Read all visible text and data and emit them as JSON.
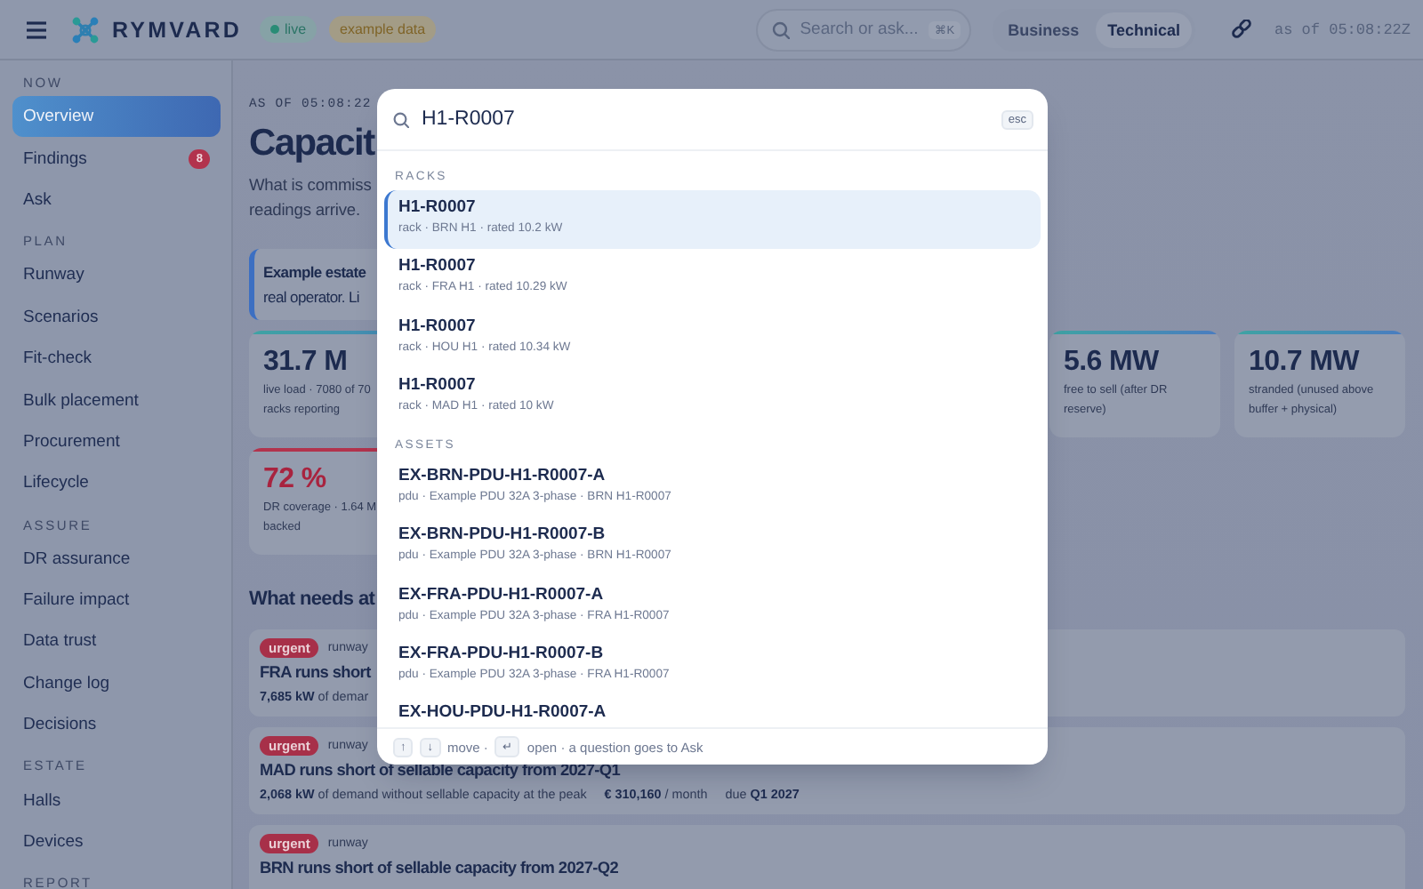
{
  "topbar": {
    "brand": "RYMVARD",
    "status_badge": "live",
    "data_badge": "example data",
    "search": {
      "placeholder": "Search or ask...",
      "shortcut": "⌘K"
    },
    "view_toggle": [
      {
        "label": "Business",
        "selected": false
      },
      {
        "label": "Technical",
        "selected": true
      }
    ],
    "as_of": "as of 05:08:22Z"
  },
  "sidebar": {
    "sections": [
      {
        "label": "NOW",
        "items": [
          {
            "label": "Overview",
            "selected": true
          },
          {
            "label": "Findings",
            "selected": false,
            "badge": "8"
          },
          {
            "label": "Ask",
            "selected": false
          }
        ]
      },
      {
        "label": "PLAN",
        "items": [
          {
            "label": "Runway",
            "selected": false
          },
          {
            "label": "Scenarios",
            "selected": false
          },
          {
            "label": "Fit-check",
            "selected": false
          },
          {
            "label": "Bulk placement",
            "selected": false
          },
          {
            "label": "Procurement",
            "selected": false
          },
          {
            "label": "Lifecycle",
            "selected": false
          }
        ]
      },
      {
        "label": "ASSURE",
        "items": [
          {
            "label": "DR assurance",
            "selected": false
          },
          {
            "label": "Failure impact",
            "selected": false
          },
          {
            "label": "Data trust",
            "selected": false
          },
          {
            "label": "Change log",
            "selected": false
          },
          {
            "label": "Decisions",
            "selected": false
          }
        ]
      },
      {
        "label": "ESTATE",
        "items": [
          {
            "label": "Halls",
            "selected": false
          },
          {
            "label": "Devices",
            "selected": false
          }
        ]
      },
      {
        "label": "REPORT"
      }
    ]
  },
  "page": {
    "as_of": "AS OF 05:08:22",
    "title": "Capacit",
    "subtitle_lines": [
      "What is commiss",
      "readings arrive."
    ],
    "callout": {
      "title": "Example estate",
      "text": "real operator. Li"
    },
    "stat_rows": [
      [
        {
          "kind": "normal",
          "value": "31.7 M",
          "caption_lines": [
            "live load · 7080 of 70",
            "racks reporting"
          ]
        },
        {
          "kind": "normal",
          "value": "5.6 MW",
          "caption_lines": [
            "free to sell (after DR",
            "reserve)"
          ]
        },
        {
          "kind": "normal",
          "value": "10.7 MW",
          "caption_lines": [
            "stranded (unused above",
            "buffer + physical)"
          ]
        }
      ],
      [
        {
          "kind": "alert",
          "value": "72 %",
          "caption_lines": [
            "DR coverage · 1.64 M",
            "backed"
          ]
        }
      ]
    ],
    "section_title": "What needs at",
    "findings": [
      {
        "severity": "urgent",
        "area": "runway",
        "title": "FRA runs short",
        "detail": "**7,685 kW** of demar"
      },
      {
        "severity": "urgent",
        "area": "runway",
        "title": "MAD runs short of sellable capacity from 2027-Q1",
        "detail": "**2,068 kW** of demand without sellable capacity at the peak",
        "cost": "**€ 310,160** / month",
        "due": "due **Q1 2027**"
      },
      {
        "severity": "urgent",
        "area": "runway",
        "title": "BRN runs short of sellable capacity from 2027-Q2"
      }
    ]
  },
  "search_dialog": {
    "query": "H1-R0007",
    "close_key": "esc",
    "groups": [
      {
        "label": "RACKS",
        "results": [
          {
            "title": "H1-R0007",
            "detail": "rack · BRN H1 · rated 10.2 kW",
            "selected": true
          },
          {
            "title": "H1-R0007",
            "detail": "rack · FRA H1 · rated 10.29 kW",
            "selected": false
          },
          {
            "title": "H1-R0007",
            "detail": "rack · HOU H1 · rated 10.34 kW",
            "selected": false
          },
          {
            "title": "H1-R0007",
            "detail": "rack · MAD H1 · rated 10 kW",
            "selected": false
          }
        ]
      },
      {
        "label": "ASSETS",
        "results": [
          {
            "title": "EX-BRN-PDU-H1-R0007-A",
            "detail": "pdu · Example PDU 32A 3-phase · BRN H1-R0007",
            "selected": false
          },
          {
            "title": "EX-BRN-PDU-H1-R0007-B",
            "detail": "pdu · Example PDU 32A 3-phase · BRN H1-R0007",
            "selected": false
          },
          {
            "title": "EX-FRA-PDU-H1-R0007-A",
            "detail": "pdu · Example PDU 32A 3-phase · FRA H1-R0007",
            "selected": false
          },
          {
            "title": "EX-FRA-PDU-H1-R0007-B",
            "detail": "pdu · Example PDU 32A 3-phase · FRA H1-R0007",
            "selected": false
          },
          {
            "title": "EX-HOU-PDU-H1-R0007-A",
            "selected": false
          }
        ]
      }
    ],
    "footer": [
      {
        "kind": "key",
        "text": "↑"
      },
      {
        "kind": "key",
        "text": "↓"
      },
      {
        "kind": "text",
        "text": "move ·"
      },
      {
        "kind": "key",
        "text": "↵"
      },
      {
        "kind": "text",
        "text": "open · a question goes to Ask"
      }
    ]
  }
}
